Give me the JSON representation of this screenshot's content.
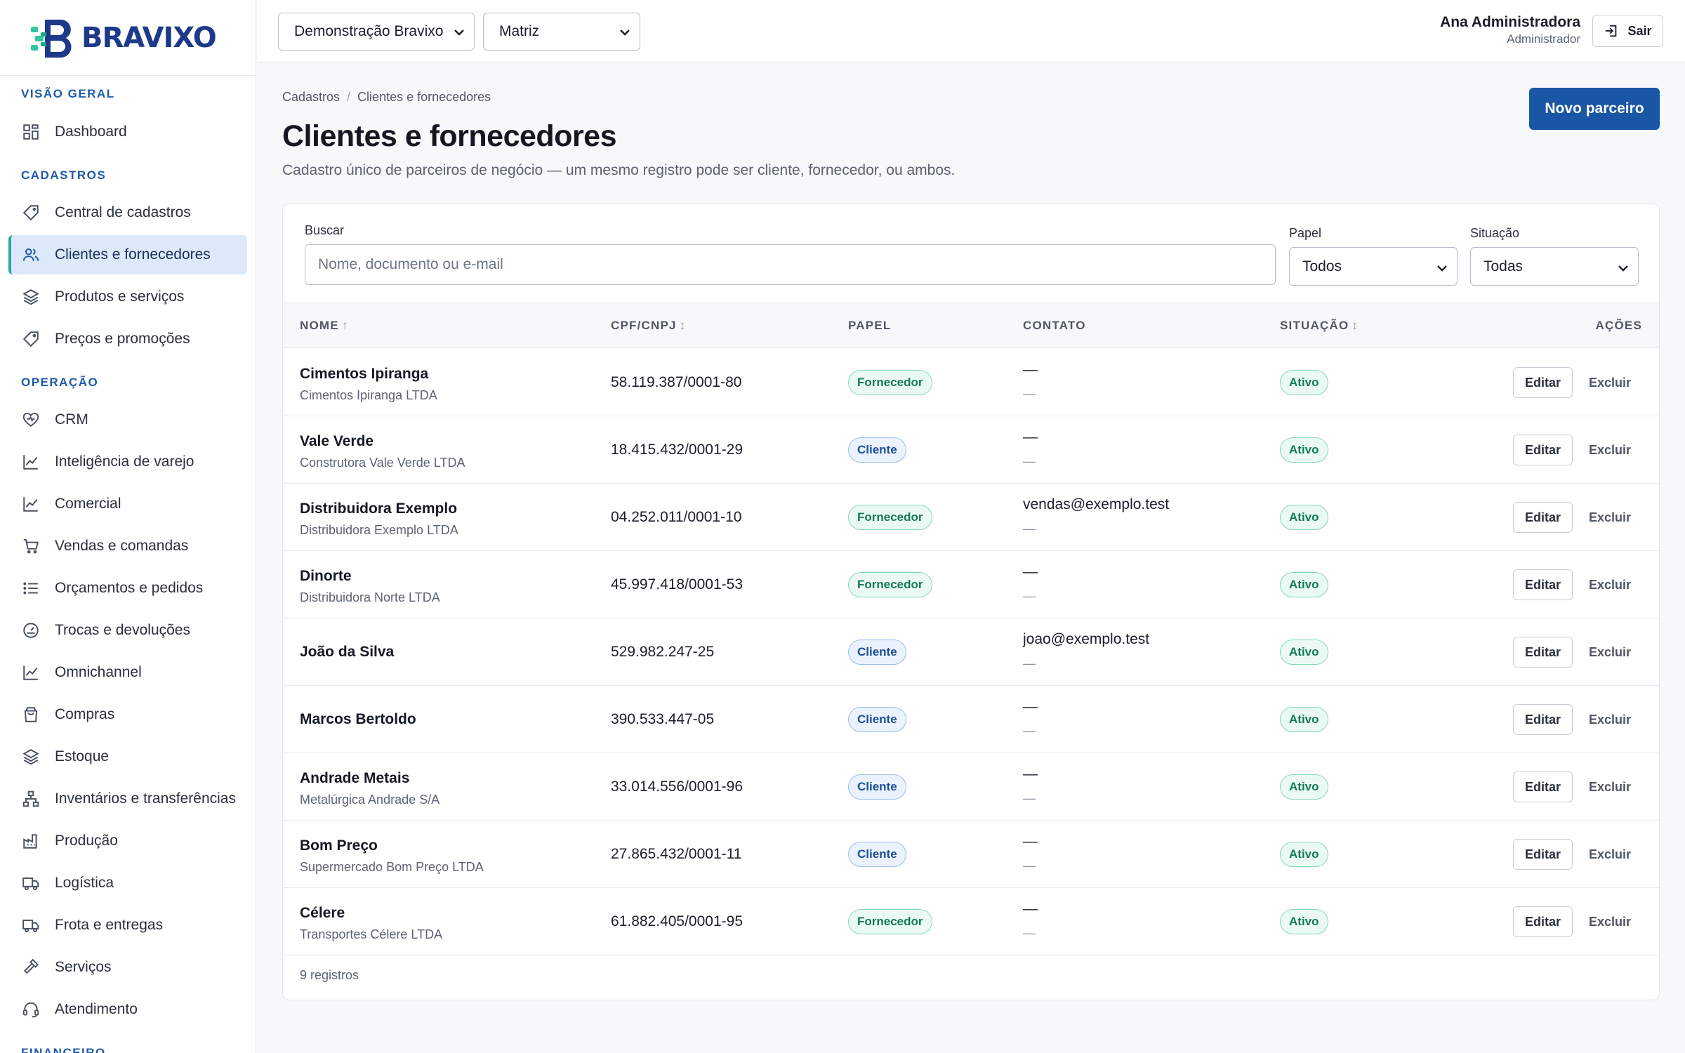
{
  "brand": {
    "name": "BRAVIXO",
    "logo_color": "#1d3a8a",
    "accent_color": "#2aa9a0"
  },
  "topbar": {
    "company_select": "Demonstração Bravixo",
    "branch_select": "Matriz",
    "user_name": "Ana Administradora",
    "user_role": "Administrador",
    "logout_label": "Sair"
  },
  "sidebar": {
    "sections": [
      {
        "label": "VISÃO GERAL"
      },
      {
        "label": "CADASTROS"
      },
      {
        "label": "OPERAÇÃO"
      },
      {
        "label": "FINANCEIRO"
      }
    ],
    "items": [
      {
        "label": "Dashboard",
        "icon": "grid-icon"
      },
      {
        "label": "Central de cadastros",
        "icon": "tag-icon"
      },
      {
        "label": "Clientes e fornecedores",
        "icon": "users-icon",
        "active": true
      },
      {
        "label": "Produtos e serviços",
        "icon": "layers-icon"
      },
      {
        "label": "Preços e promoções",
        "icon": "tag-icon"
      },
      {
        "label": "CRM",
        "icon": "heart-icon"
      },
      {
        "label": "Inteligência de varejo",
        "icon": "chart-line-icon"
      },
      {
        "label": "Comercial",
        "icon": "chart-line-icon"
      },
      {
        "label": "Vendas e comandas",
        "icon": "cart-icon"
      },
      {
        "label": "Orçamentos e pedidos",
        "icon": "list-icon"
      },
      {
        "label": "Trocas e devoluções",
        "icon": "gauge-icon"
      },
      {
        "label": "Omnichannel",
        "icon": "chart-line-icon"
      },
      {
        "label": "Compras",
        "icon": "bag-icon"
      },
      {
        "label": "Estoque",
        "icon": "layers-icon"
      },
      {
        "label": "Inventários e transferências",
        "icon": "network-icon"
      },
      {
        "label": "Produção",
        "icon": "factory-icon"
      },
      {
        "label": "Logística",
        "icon": "truck-icon"
      },
      {
        "label": "Frota e entregas",
        "icon": "truck-icon"
      },
      {
        "label": "Serviços",
        "icon": "hammer-icon"
      },
      {
        "label": "Atendimento",
        "icon": "headset-icon"
      }
    ]
  },
  "page": {
    "breadcrumb_root": "Cadastros",
    "breadcrumb_separator": "/",
    "breadcrumb_current": "Clientes e fornecedores",
    "title": "Clientes e fornecedores",
    "subtitle": "Cadastro único de parceiros de negócio — um mesmo registro pode ser cliente, fornecedor, ou ambos.",
    "new_button": "Novo parceiro"
  },
  "filters": {
    "search_label": "Buscar",
    "search_placeholder": "Nome, documento ou e-mail",
    "role_label": "Papel",
    "role_value": "Todos",
    "status_label": "Situação",
    "status_value": "Todas"
  },
  "table": {
    "columns": {
      "name": "NOME",
      "name_sort": "↑",
      "doc": "CPF/CNPJ",
      "doc_sort": "↕",
      "role": "PAPEL",
      "contact": "CONTATO",
      "status": "SITUAÇÃO",
      "status_sort": "↕",
      "actions": "AÇÕES"
    },
    "edit_label": "Editar",
    "delete_label": "Excluir",
    "rows": [
      {
        "name": "Cimentos Ipiranga",
        "legal": "Cimentos Ipiranga LTDA",
        "doc": "58.119.387/0001-80",
        "role": "Fornecedor",
        "contact": "—",
        "contact2": "—",
        "status": "Ativo"
      },
      {
        "name": "Vale Verde",
        "legal": "Construtora Vale Verde LTDA",
        "doc": "18.415.432/0001-29",
        "role": "Cliente",
        "contact": "—",
        "contact2": "—",
        "status": "Ativo"
      },
      {
        "name": "Distribuidora Exemplo",
        "legal": "Distribuidora Exemplo LTDA",
        "doc": "04.252.011/0001-10",
        "role": "Fornecedor",
        "contact": "vendas@exemplo.test",
        "contact2": "—",
        "status": "Ativo"
      },
      {
        "name": "Dinorte",
        "legal": "Distribuidora Norte LTDA",
        "doc": "45.997.418/0001-53",
        "role": "Fornecedor",
        "contact": "—",
        "contact2": "—",
        "status": "Ativo"
      },
      {
        "name": "João da Silva",
        "legal": "",
        "doc": "529.982.247-25",
        "role": "Cliente",
        "contact": "joao@exemplo.test",
        "contact2": "—",
        "status": "Ativo"
      },
      {
        "name": "Marcos Bertoldo",
        "legal": "",
        "doc": "390.533.447-05",
        "role": "Cliente",
        "contact": "—",
        "contact2": "—",
        "status": "Ativo"
      },
      {
        "name": "Andrade Metais",
        "legal": "Metalúrgica Andrade S/A",
        "doc": "33.014.556/0001-96",
        "role": "Cliente",
        "contact": "—",
        "contact2": "—",
        "status": "Ativo"
      },
      {
        "name": "Bom Preço",
        "legal": "Supermercado Bom Preço LTDA",
        "doc": "27.865.432/0001-11",
        "role": "Cliente",
        "contact": "—",
        "contact2": "—",
        "status": "Ativo"
      },
      {
        "name": "Célere",
        "legal": "Transportes Célere LTDA",
        "doc": "61.882.405/0001-95",
        "role": "Fornecedor",
        "contact": "—",
        "contact2": "—",
        "status": "Ativo"
      }
    ],
    "footer": "9 registros"
  }
}
